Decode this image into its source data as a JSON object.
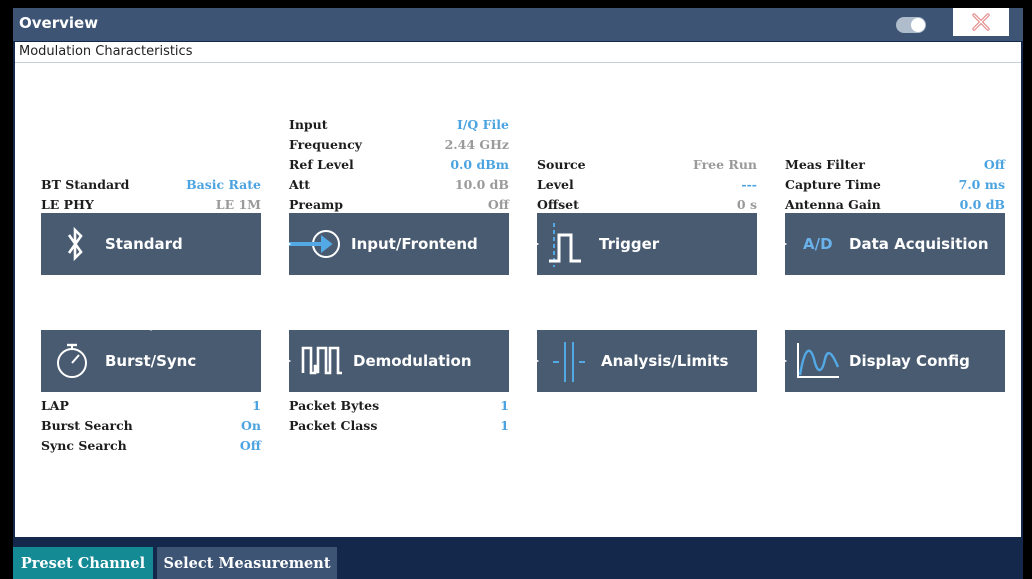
{
  "window": {
    "title": "Overview",
    "subtitle": "Modulation Characteristics"
  },
  "colors": {
    "block": "#495b70",
    "value": "#4ba3e0",
    "accent": "#138a94"
  },
  "blocks": {
    "standard": {
      "label": "Standard",
      "icon": "bluetooth-icon"
    },
    "input": {
      "label": "Input/Frontend",
      "icon": "input-arrow-icon"
    },
    "trigger": {
      "label": "Trigger",
      "icon": "trigger-pulse-icon"
    },
    "acquisition": {
      "label": "Data Acquisition",
      "icon": "ad-converter-icon",
      "icon_text": "A/D"
    },
    "burst": {
      "label": "Burst/Sync",
      "icon": "stopwatch-icon"
    },
    "demod": {
      "label": "Demodulation",
      "icon": "demodulation-icon"
    },
    "analysis": {
      "label": "Analysis/Limits",
      "icon": "limits-icon"
    },
    "display": {
      "label": "Display Config",
      "icon": "display-config-icon"
    }
  },
  "standard_info": [
    {
      "key": "BT Standard",
      "value": "Basic Rate"
    },
    {
      "key": "LE PHY",
      "value": "LE 1M"
    }
  ],
  "input_info": [
    {
      "key": "Input",
      "value": "I/Q File"
    },
    {
      "key": "Frequency",
      "value": "2.44 GHz"
    },
    {
      "key": "Ref Level",
      "value": "0.0 dBm"
    },
    {
      "key": "Att",
      "value": "10.0 dB"
    },
    {
      "key": "Preamp",
      "value": "Off"
    }
  ],
  "trigger_info": [
    {
      "key": "Source",
      "value": "Free Run"
    },
    {
      "key": "Level",
      "value": "---"
    },
    {
      "key": "Offset",
      "value": "0 s"
    }
  ],
  "acq_info": [
    {
      "key": "Meas Filter",
      "value": "Off"
    },
    {
      "key": "Capture Time",
      "value": "7.0 ms"
    },
    {
      "key": "Antenna Gain",
      "value": "0.0 dB"
    }
  ],
  "burst_info": [
    {
      "key": "LAP",
      "value": "1"
    },
    {
      "key": "Burst Search",
      "value": "On"
    },
    {
      "key": "Sync Search",
      "value": "Off"
    }
  ],
  "demod_info": [
    {
      "key": "Packet Bytes",
      "value": "1"
    },
    {
      "key": "Packet Class",
      "value": "1"
    }
  ],
  "footer": {
    "preset_label": "Preset Channel",
    "select_label": "Select Measurement"
  }
}
